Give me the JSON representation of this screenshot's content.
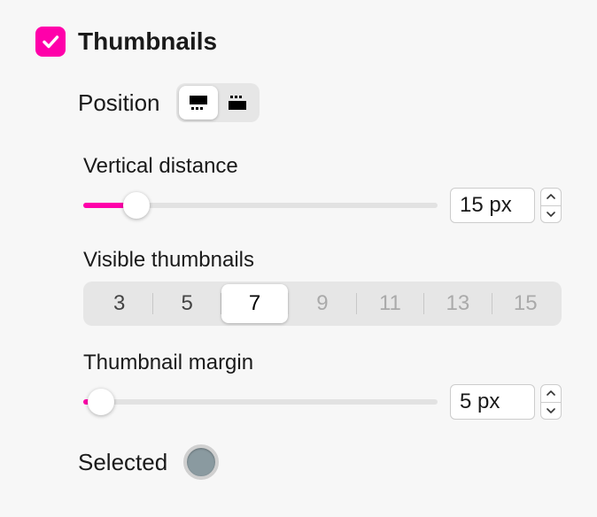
{
  "section": {
    "title": "Thumbnails",
    "checked": true
  },
  "position": {
    "label": "Position",
    "options": [
      "bottom",
      "top"
    ],
    "selected": "bottom"
  },
  "vertical_distance": {
    "label": "Vertical distance",
    "value": 15,
    "display": "15 px",
    "min": 0,
    "max": 100,
    "percent": 15
  },
  "visible_thumbnails": {
    "label": "Visible thumbnails",
    "options": [
      "3",
      "5",
      "7",
      "9",
      "11",
      "13",
      "15"
    ],
    "selected": "7"
  },
  "thumbnail_margin": {
    "label": "Thumbnail margin",
    "value": 5,
    "display": "5 px",
    "min": 0,
    "max": 100,
    "percent": 5
  },
  "selected_color": {
    "label": "Selected",
    "color": "#8a9aa0"
  }
}
